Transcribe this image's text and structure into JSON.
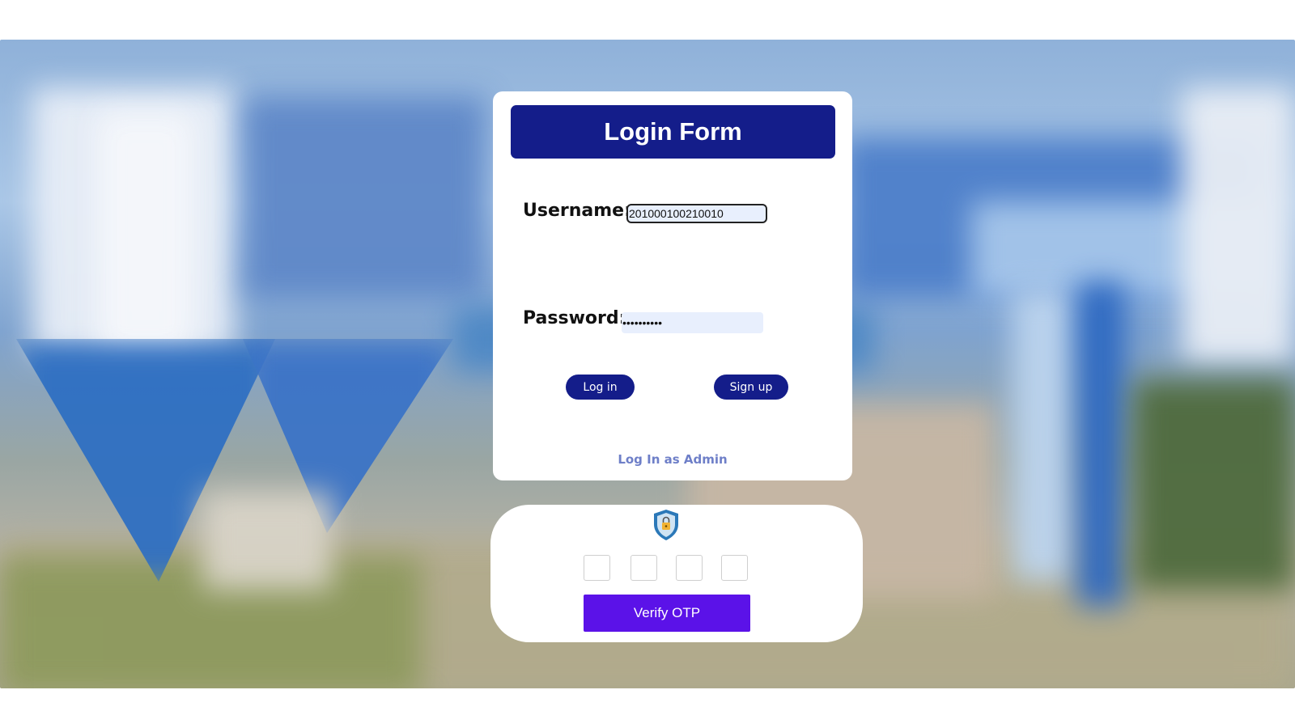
{
  "login_form": {
    "title": "Login Form",
    "username_label": "Username:",
    "username_value": "201000100210010",
    "password_label": "Password:",
    "password_value": "••••••••••",
    "login_button": "Log in",
    "signup_button": "Sign up",
    "admin_link": "Log In as Admin"
  },
  "otp": {
    "shield_icon": "shield-lock-icon",
    "digits": [
      "",
      "",
      "",
      ""
    ],
    "verify_button": "Verify OTP"
  },
  "colors": {
    "header_navy": "#141d8a",
    "verify_purple": "#5b12e8",
    "link_color": "#6e7fc8"
  }
}
